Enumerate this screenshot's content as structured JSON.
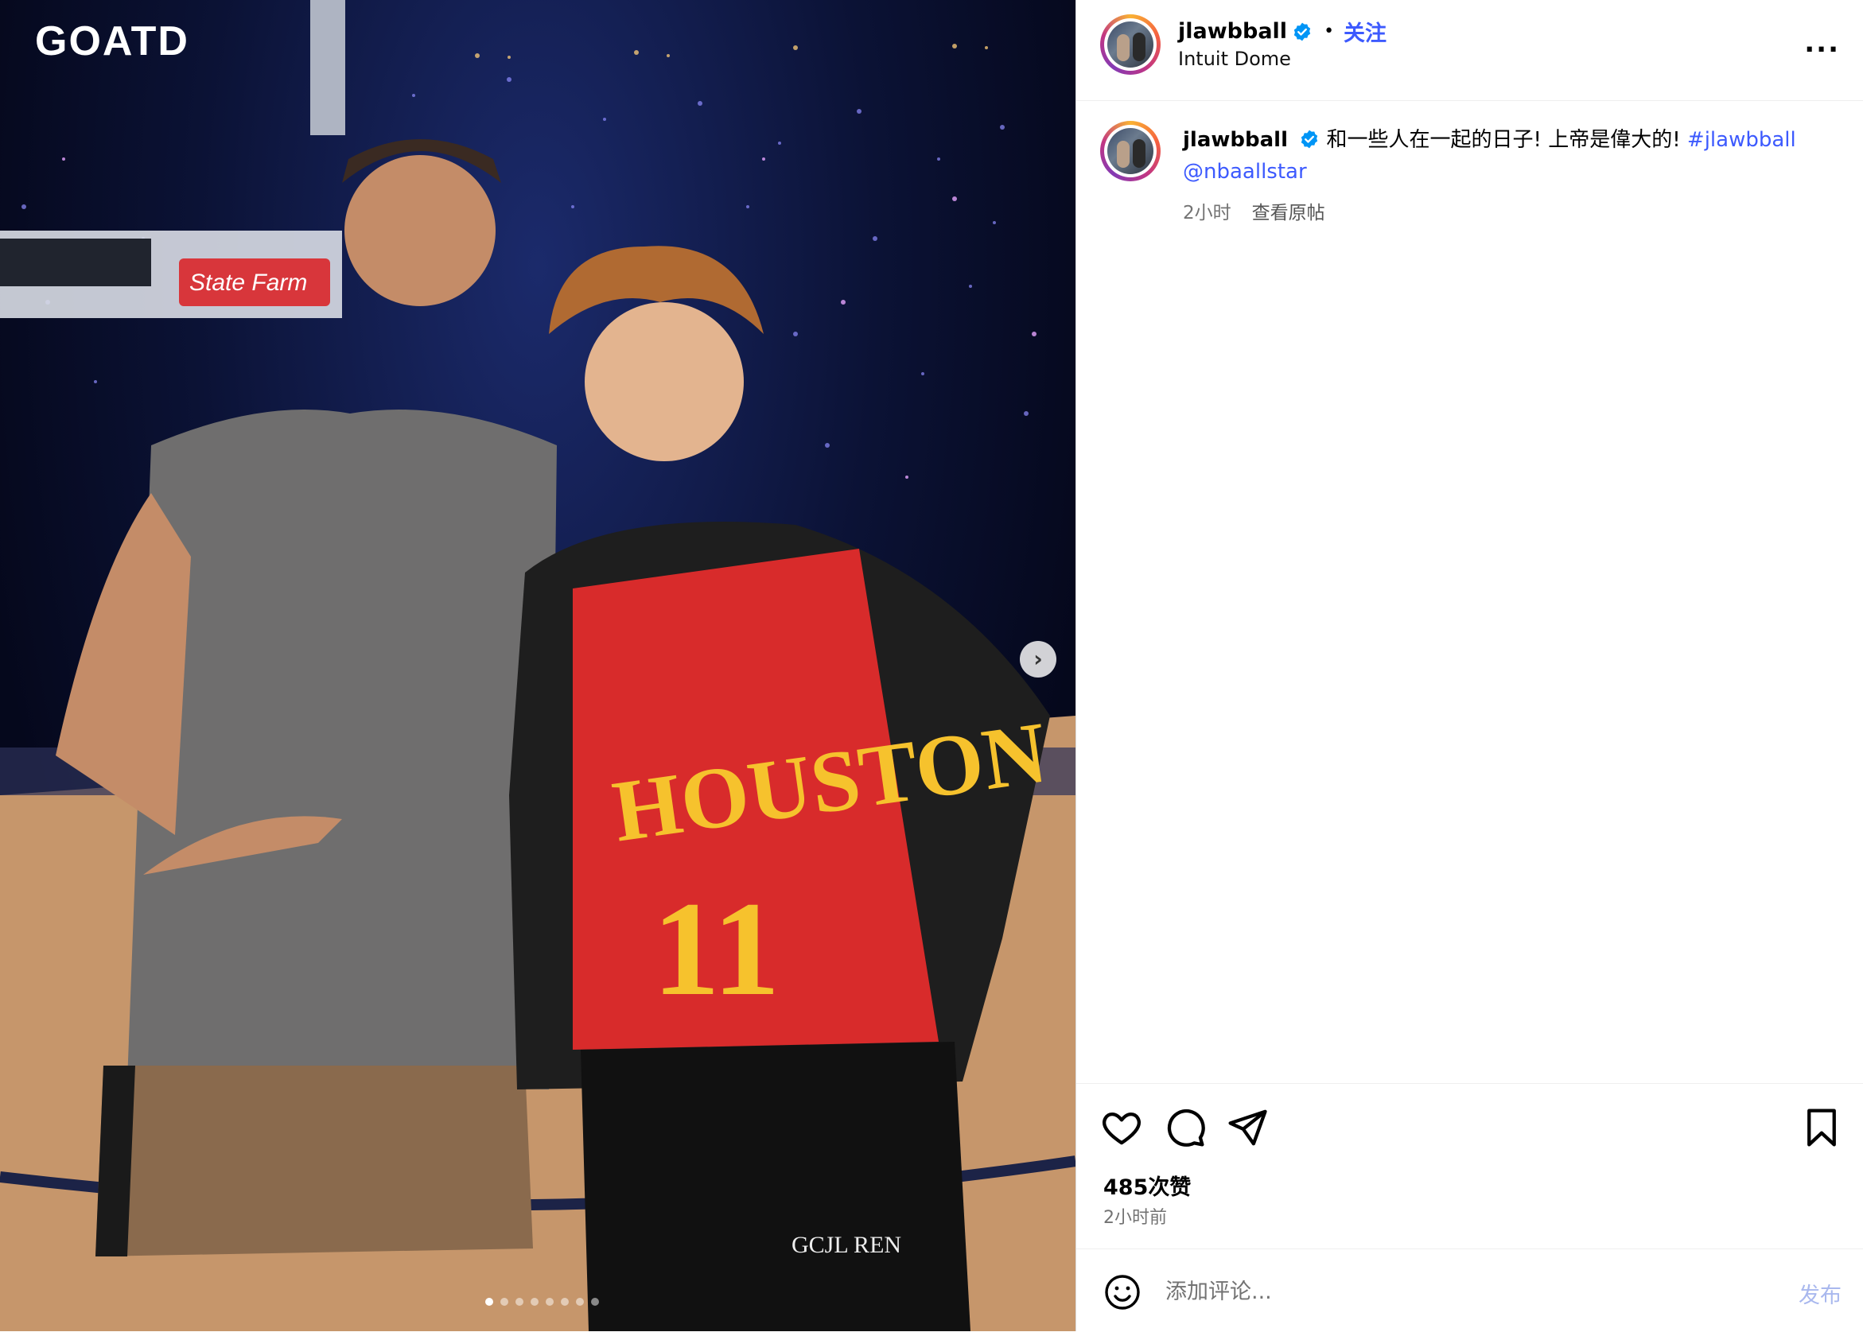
{
  "photo": {
    "watermark": "GOATD",
    "carousel_total": 8,
    "carousel_active": 0,
    "scene": {
      "banner_text": "State Farm",
      "jersey_team": "HOUSTON",
      "jersey_number": "11",
      "pants_text": "GCJL REN"
    }
  },
  "header": {
    "username": "jlawbball",
    "separator": "•",
    "follow_label": "关注",
    "location": "Intuit Dome",
    "more_label": "..."
  },
  "caption": {
    "username": "jlawbball",
    "text": "和一些人在一起的日子! 上帝是偉大的! ",
    "hashtag": "#jlawbball",
    "mention": "@nbaallstar",
    "time": "2小时",
    "see_original": "查看原帖"
  },
  "actions": {
    "likes": "485次赞",
    "time_ago": "2小时前"
  },
  "comment": {
    "placeholder": "添加评论...",
    "post_label": "发布"
  },
  "colors": {
    "link": "#3d5afe",
    "verified": "#0095f6",
    "secondary_text": "#737373"
  }
}
